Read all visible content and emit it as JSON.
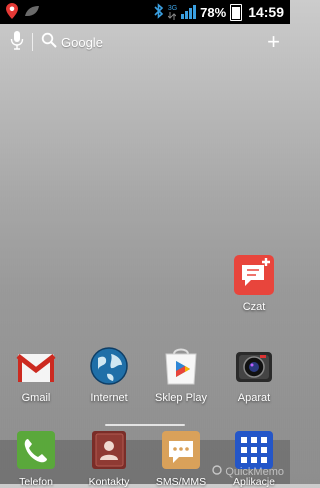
{
  "statusbar": {
    "network_type": "3G",
    "battery_percent": "78%",
    "time": "14:59",
    "icons": [
      "location-pin-icon",
      "leaf-icon",
      "bluetooth-icon",
      "network-3g-icon",
      "signal-bars-icon",
      "battery-icon"
    ]
  },
  "search": {
    "label": "Google",
    "add_button": "+"
  },
  "apps": [
    {
      "label": "Czat"
    },
    {
      "label": "Gmail"
    },
    {
      "label": "Internet"
    },
    {
      "label": "Sklep Play"
    },
    {
      "label": "Aparat"
    }
  ],
  "dock": [
    {
      "label": "Telefon"
    },
    {
      "label": "Kontakty"
    },
    {
      "label": "SMS/MMS"
    },
    {
      "label": "Aplikacje"
    }
  ],
  "watermark": "QuickMemo",
  "colors": {
    "statusbar_bg": "#000000",
    "accent_blue": "#3a9fe0"
  }
}
